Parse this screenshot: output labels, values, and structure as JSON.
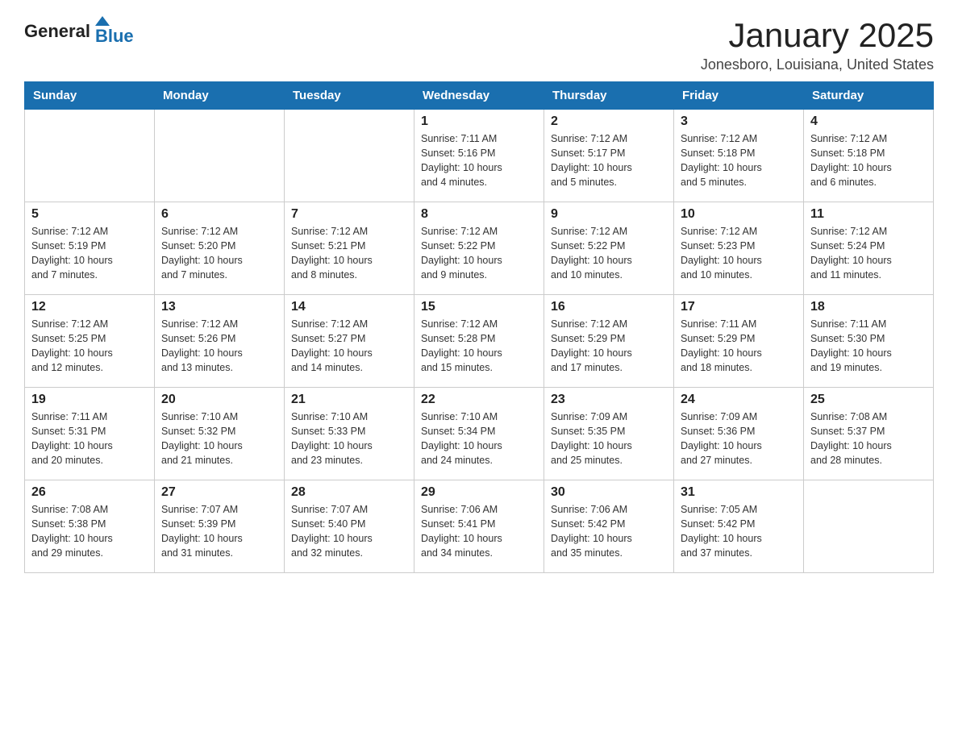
{
  "header": {
    "logo_general": "General",
    "logo_blue": "Blue",
    "month_title": "January 2025",
    "location": "Jonesboro, Louisiana, United States"
  },
  "weekdays": [
    "Sunday",
    "Monday",
    "Tuesday",
    "Wednesday",
    "Thursday",
    "Friday",
    "Saturday"
  ],
  "weeks": [
    [
      {
        "day": "",
        "info": ""
      },
      {
        "day": "",
        "info": ""
      },
      {
        "day": "",
        "info": ""
      },
      {
        "day": "1",
        "info": "Sunrise: 7:11 AM\nSunset: 5:16 PM\nDaylight: 10 hours\nand 4 minutes."
      },
      {
        "day": "2",
        "info": "Sunrise: 7:12 AM\nSunset: 5:17 PM\nDaylight: 10 hours\nand 5 minutes."
      },
      {
        "day": "3",
        "info": "Sunrise: 7:12 AM\nSunset: 5:18 PM\nDaylight: 10 hours\nand 5 minutes."
      },
      {
        "day": "4",
        "info": "Sunrise: 7:12 AM\nSunset: 5:18 PM\nDaylight: 10 hours\nand 6 minutes."
      }
    ],
    [
      {
        "day": "5",
        "info": "Sunrise: 7:12 AM\nSunset: 5:19 PM\nDaylight: 10 hours\nand 7 minutes."
      },
      {
        "day": "6",
        "info": "Sunrise: 7:12 AM\nSunset: 5:20 PM\nDaylight: 10 hours\nand 7 minutes."
      },
      {
        "day": "7",
        "info": "Sunrise: 7:12 AM\nSunset: 5:21 PM\nDaylight: 10 hours\nand 8 minutes."
      },
      {
        "day": "8",
        "info": "Sunrise: 7:12 AM\nSunset: 5:22 PM\nDaylight: 10 hours\nand 9 minutes."
      },
      {
        "day": "9",
        "info": "Sunrise: 7:12 AM\nSunset: 5:22 PM\nDaylight: 10 hours\nand 10 minutes."
      },
      {
        "day": "10",
        "info": "Sunrise: 7:12 AM\nSunset: 5:23 PM\nDaylight: 10 hours\nand 10 minutes."
      },
      {
        "day": "11",
        "info": "Sunrise: 7:12 AM\nSunset: 5:24 PM\nDaylight: 10 hours\nand 11 minutes."
      }
    ],
    [
      {
        "day": "12",
        "info": "Sunrise: 7:12 AM\nSunset: 5:25 PM\nDaylight: 10 hours\nand 12 minutes."
      },
      {
        "day": "13",
        "info": "Sunrise: 7:12 AM\nSunset: 5:26 PM\nDaylight: 10 hours\nand 13 minutes."
      },
      {
        "day": "14",
        "info": "Sunrise: 7:12 AM\nSunset: 5:27 PM\nDaylight: 10 hours\nand 14 minutes."
      },
      {
        "day": "15",
        "info": "Sunrise: 7:12 AM\nSunset: 5:28 PM\nDaylight: 10 hours\nand 15 minutes."
      },
      {
        "day": "16",
        "info": "Sunrise: 7:12 AM\nSunset: 5:29 PM\nDaylight: 10 hours\nand 17 minutes."
      },
      {
        "day": "17",
        "info": "Sunrise: 7:11 AM\nSunset: 5:29 PM\nDaylight: 10 hours\nand 18 minutes."
      },
      {
        "day": "18",
        "info": "Sunrise: 7:11 AM\nSunset: 5:30 PM\nDaylight: 10 hours\nand 19 minutes."
      }
    ],
    [
      {
        "day": "19",
        "info": "Sunrise: 7:11 AM\nSunset: 5:31 PM\nDaylight: 10 hours\nand 20 minutes."
      },
      {
        "day": "20",
        "info": "Sunrise: 7:10 AM\nSunset: 5:32 PM\nDaylight: 10 hours\nand 21 minutes."
      },
      {
        "day": "21",
        "info": "Sunrise: 7:10 AM\nSunset: 5:33 PM\nDaylight: 10 hours\nand 23 minutes."
      },
      {
        "day": "22",
        "info": "Sunrise: 7:10 AM\nSunset: 5:34 PM\nDaylight: 10 hours\nand 24 minutes."
      },
      {
        "day": "23",
        "info": "Sunrise: 7:09 AM\nSunset: 5:35 PM\nDaylight: 10 hours\nand 25 minutes."
      },
      {
        "day": "24",
        "info": "Sunrise: 7:09 AM\nSunset: 5:36 PM\nDaylight: 10 hours\nand 27 minutes."
      },
      {
        "day": "25",
        "info": "Sunrise: 7:08 AM\nSunset: 5:37 PM\nDaylight: 10 hours\nand 28 minutes."
      }
    ],
    [
      {
        "day": "26",
        "info": "Sunrise: 7:08 AM\nSunset: 5:38 PM\nDaylight: 10 hours\nand 29 minutes."
      },
      {
        "day": "27",
        "info": "Sunrise: 7:07 AM\nSunset: 5:39 PM\nDaylight: 10 hours\nand 31 minutes."
      },
      {
        "day": "28",
        "info": "Sunrise: 7:07 AM\nSunset: 5:40 PM\nDaylight: 10 hours\nand 32 minutes."
      },
      {
        "day": "29",
        "info": "Sunrise: 7:06 AM\nSunset: 5:41 PM\nDaylight: 10 hours\nand 34 minutes."
      },
      {
        "day": "30",
        "info": "Sunrise: 7:06 AM\nSunset: 5:42 PM\nDaylight: 10 hours\nand 35 minutes."
      },
      {
        "day": "31",
        "info": "Sunrise: 7:05 AM\nSunset: 5:42 PM\nDaylight: 10 hours\nand 37 minutes."
      },
      {
        "day": "",
        "info": ""
      }
    ]
  ]
}
